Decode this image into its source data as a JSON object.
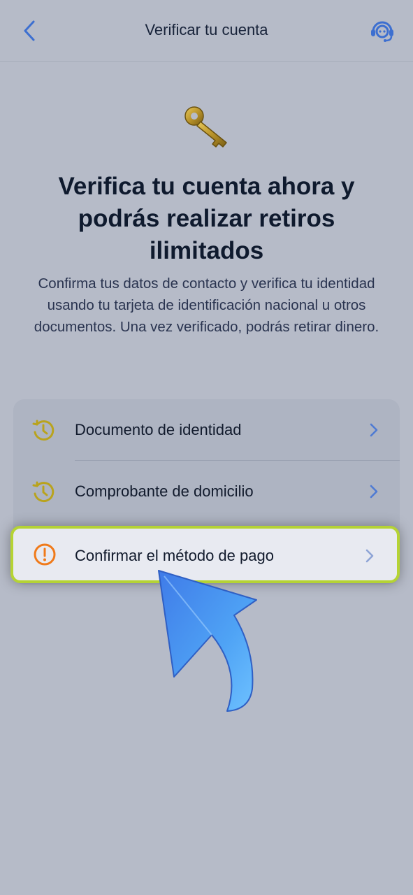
{
  "header": {
    "title": "Verificar tu cuenta",
    "back_icon": "chevron-left-icon",
    "support_icon": "headset-support-icon"
  },
  "hero": {
    "icon": "key-icon",
    "headline": "Verifica tu cuenta ahora y podrás realizar retiros ilimitados",
    "description": "Confirma tus datos de contacto y verifica tu identidad usando tu tarjeta de identificación nacional u otros documentos. Una vez verificado, podrás retirar dinero."
  },
  "steps": [
    {
      "label": "Documento de identidad",
      "status": "pending",
      "icon": "clock-pending-icon"
    },
    {
      "label": "Comprobante de domicilio",
      "status": "pending",
      "icon": "clock-pending-icon"
    },
    {
      "label": "Confirmar el método de pago",
      "status": "required",
      "icon": "alert-circle-icon"
    }
  ],
  "colors": {
    "background": "#b6bbc8",
    "accent_blue": "#3d6fd0",
    "pending_gold": "#b9a31d",
    "alert_orange": "#f07a1a",
    "highlight_border": "#b5d334"
  }
}
